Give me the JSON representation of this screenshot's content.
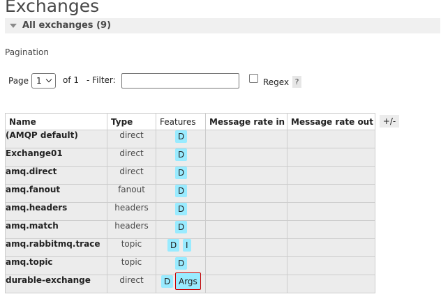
{
  "page": {
    "title": "Exchanges"
  },
  "section": {
    "title": "All exchanges (9)"
  },
  "pagination": {
    "label": "Pagination",
    "page_label": "Page",
    "page_value": "1",
    "of_label": "of 1",
    "filter_label": "- Filter:",
    "filter_value": "",
    "regex_label": "Regex",
    "help_label": "?"
  },
  "table": {
    "headers": {
      "name": "Name",
      "type": "Type",
      "features": "Features",
      "rate_in": "Message rate in",
      "rate_out": "Message rate out"
    },
    "toggle_label": "+/-",
    "rows": [
      {
        "name": "(AMQP default)",
        "type": "direct",
        "features": [
          "D"
        ]
      },
      {
        "name": "Exchange01",
        "type": "direct",
        "features": [
          "D"
        ]
      },
      {
        "name": "amq.direct",
        "type": "direct",
        "features": [
          "D"
        ]
      },
      {
        "name": "amq.fanout",
        "type": "fanout",
        "features": [
          "D"
        ]
      },
      {
        "name": "amq.headers",
        "type": "headers",
        "features": [
          "D"
        ]
      },
      {
        "name": "amq.match",
        "type": "headers",
        "features": [
          "D"
        ]
      },
      {
        "name": "amq.rabbitmq.trace",
        "type": "topic",
        "features": [
          "D",
          "I"
        ]
      },
      {
        "name": "amq.topic",
        "type": "topic",
        "features": [
          "D"
        ]
      },
      {
        "name": "durable-exchange",
        "type": "direct",
        "features": [
          "D",
          "Args"
        ]
      }
    ]
  },
  "colors": {
    "badge": "#99ebff",
    "row_bg": "#ececec",
    "highlight_border": "#cc0000"
  }
}
